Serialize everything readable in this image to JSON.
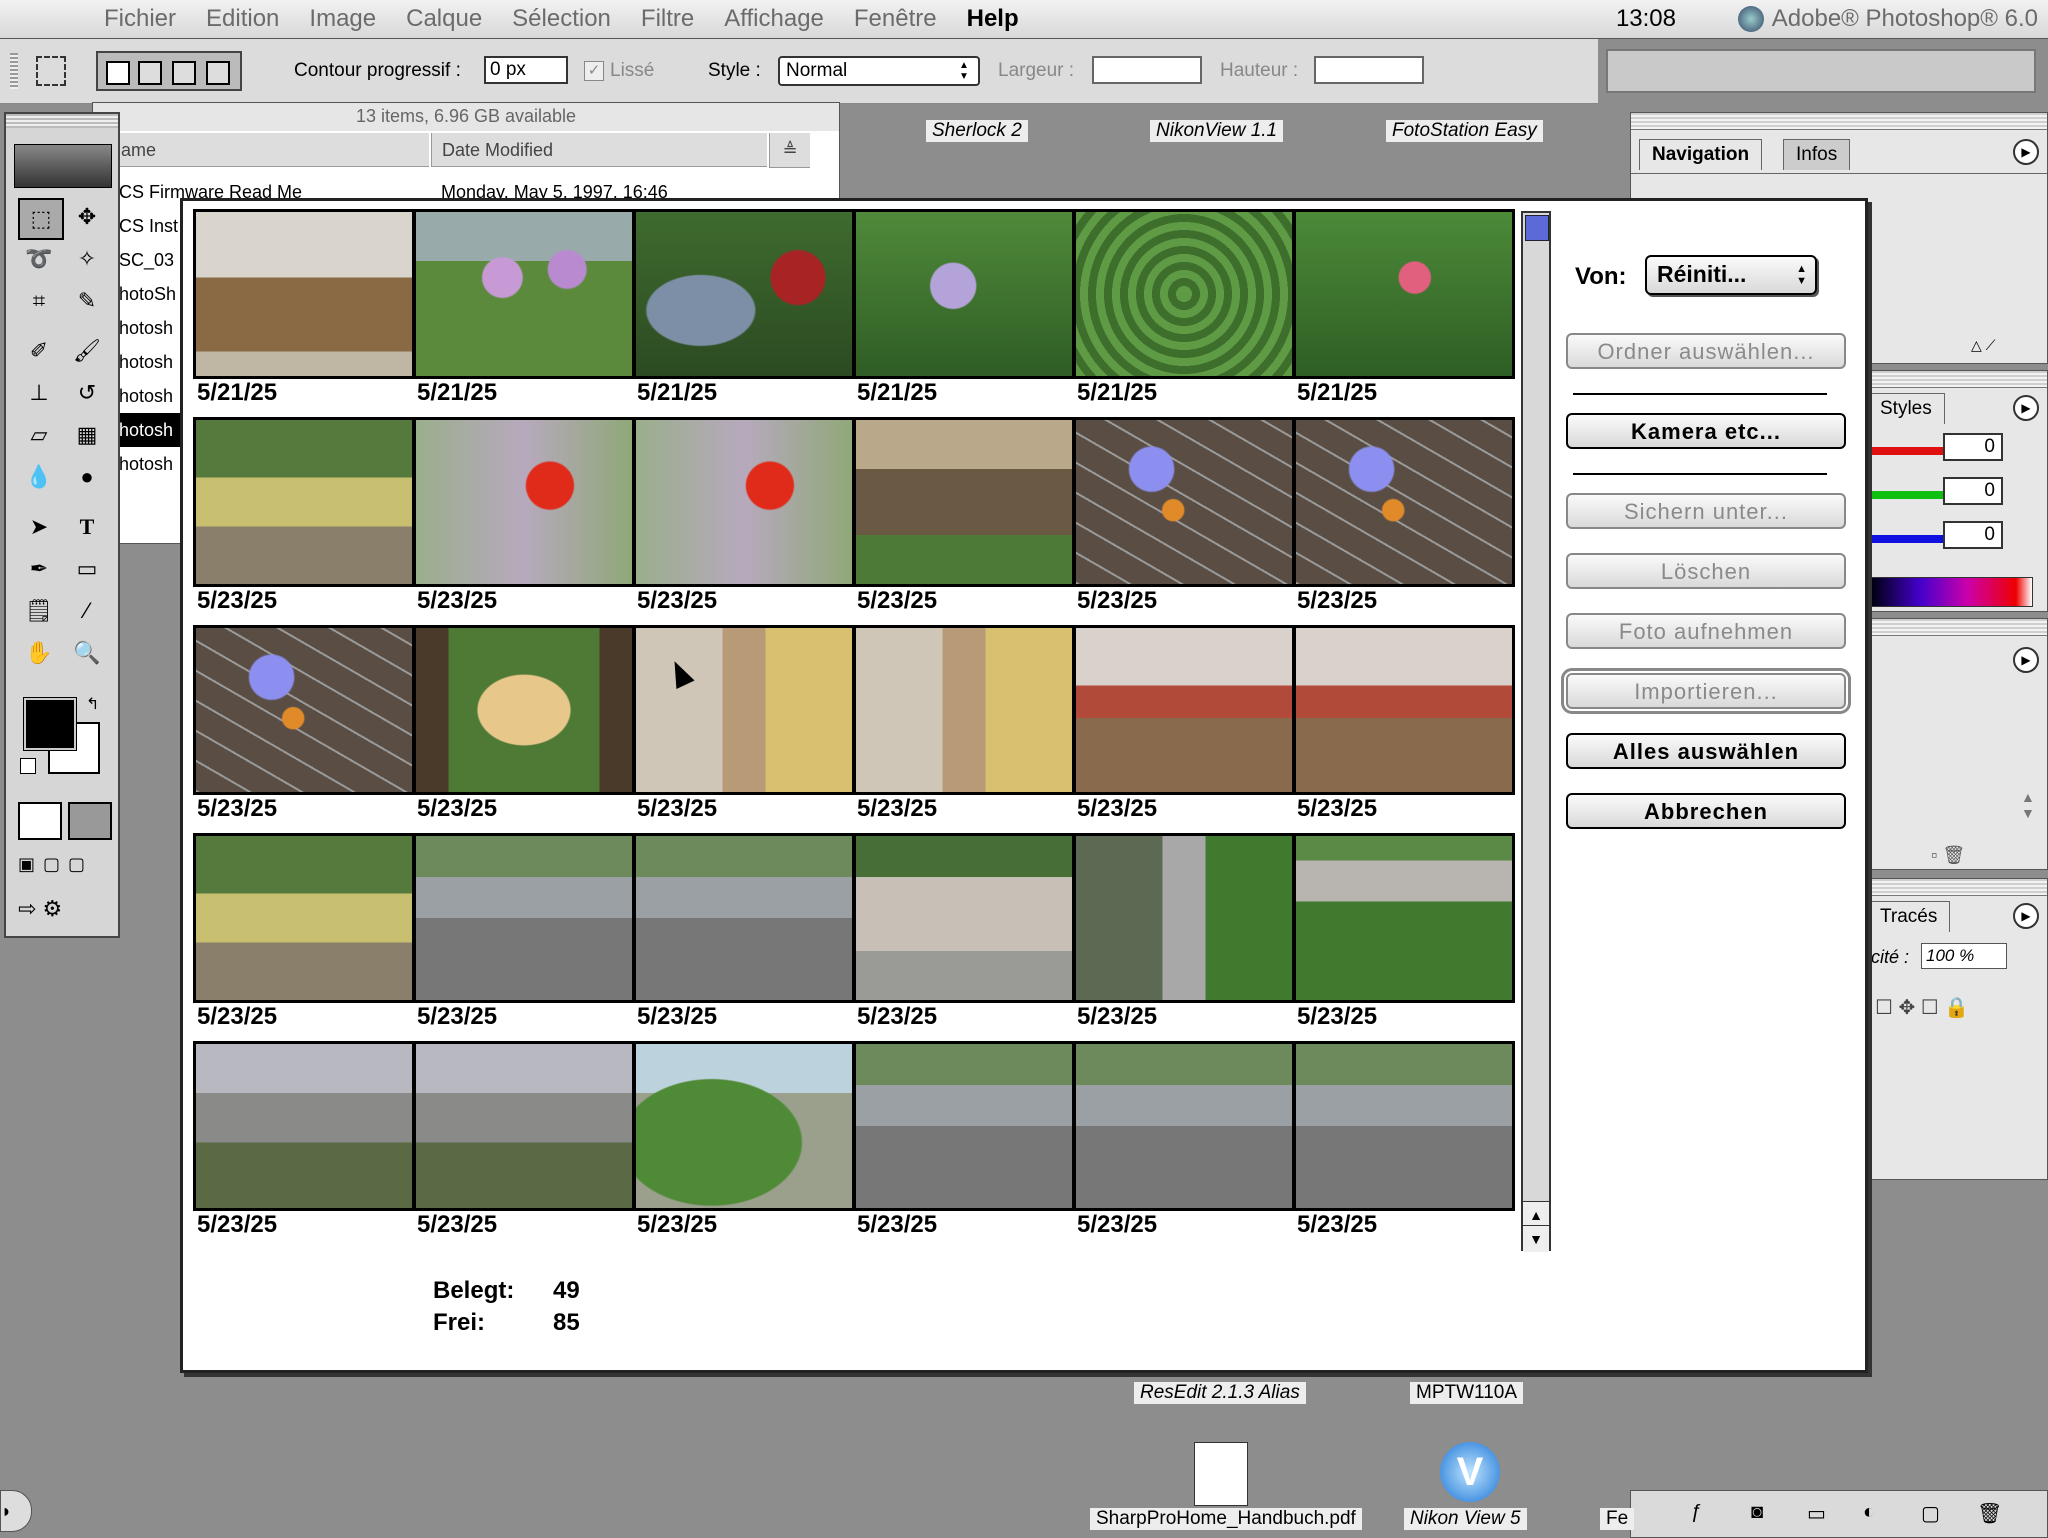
{
  "menubar": {
    "items": [
      "Fichier",
      "Edition",
      "Image",
      "Calque",
      "Sélection",
      "Filtre",
      "Affichage",
      "Fenêtre",
      "Help"
    ],
    "clock": "13:08",
    "app_name": "Adobe® Photoshop® 6.0"
  },
  "options_bar": {
    "feather_label": "Contour progressif :",
    "feather_value": "0 px",
    "antialias_label": "Lissé",
    "style_label": "Style :",
    "style_value": "Normal",
    "width_label": "Largeur :",
    "height_label": "Hauteur :"
  },
  "finder": {
    "status": "13 items, 6.96 GB available",
    "col_name": "ame",
    "col_date": "Date Modified",
    "rows": [
      {
        "name": "CS Firmware Read Me",
        "date": "Monday, May 5, 1997, 16:46"
      },
      {
        "name": "CS Inst",
        "date": ""
      },
      {
        "name": "SC_03",
        "date": ""
      },
      {
        "name": "hotoSh",
        "date": ""
      },
      {
        "name": "hotosh",
        "date": ""
      },
      {
        "name": "hotosh",
        "date": ""
      },
      {
        "name": "hotosh",
        "date": ""
      },
      {
        "name": "hotosh",
        "date": ""
      },
      {
        "name": "hotosh",
        "date": ""
      }
    ]
  },
  "desktop": {
    "top_icons": [
      "Sherlock 2",
      "NikonView 1.1",
      "FotoStation Easy"
    ],
    "bottom_icons": [
      "ResEdit 2.1.3 Alias",
      "MPTW110A",
      "SharpProHome_Handbuch.pdf",
      "Nikon View 5",
      "Fe"
    ]
  },
  "palettes": {
    "nav_tabs": [
      "Navigation",
      "Infos"
    ],
    "color_tab": "Styles",
    "rgb_values": [
      "0",
      "0",
      "0"
    ],
    "paths_tab": "Tracés",
    "opacity_label": "cité :",
    "opacity_value": "100 %"
  },
  "dialog": {
    "source_label": "Von:",
    "source_value": "Réiniti...",
    "buttons": [
      {
        "label": "Ordner auswählen...",
        "state": "disabled"
      },
      {
        "label": "Kamera etc...",
        "state": "default"
      },
      {
        "label": "Sichern unter...",
        "state": "disabled"
      },
      {
        "label": "Löschen",
        "state": "disabled"
      },
      {
        "label": "Foto aufnehmen",
        "state": "disabled"
      },
      {
        "label": "Importieren...",
        "state": "disabled"
      },
      {
        "label": "Alles auswählen",
        "state": "default"
      },
      {
        "label": "Abbrechen",
        "state": "default"
      }
    ],
    "used_label": "Belegt:",
    "used_value": "49",
    "free_label": "Frei:",
    "free_value": "85",
    "thumbnails": [
      {
        "date": "5/21/25",
        "subject": "living-room"
      },
      {
        "date": "5/21/25",
        "subject": "chives-flowers"
      },
      {
        "date": "5/21/25",
        "subject": "lantern-birdhouse"
      },
      {
        "date": "5/21/25",
        "subject": "iris-flower"
      },
      {
        "date": "5/21/25",
        "subject": "green-foliage"
      },
      {
        "date": "5/21/25",
        "subject": "pink-rose"
      },
      {
        "date": "5/23/25",
        "subject": "graffiti-wall"
      },
      {
        "date": "5/23/25",
        "subject": "red-poppy"
      },
      {
        "date": "5/23/25",
        "subject": "red-poppy"
      },
      {
        "date": "5/23/25",
        "subject": "garden-bed"
      },
      {
        "date": "5/23/25",
        "subject": "fence-decoration"
      },
      {
        "date": "5/23/25",
        "subject": "fence-decoration"
      },
      {
        "date": "5/23/25",
        "subject": "fence-decoration"
      },
      {
        "date": "5/23/25",
        "subject": "achtung-sign"
      },
      {
        "date": "5/23/25",
        "subject": "alley-graffiti"
      },
      {
        "date": "5/23/25",
        "subject": "alley-graffiti"
      },
      {
        "date": "5/23/25",
        "subject": "cafe-terrace"
      },
      {
        "date": "5/23/25",
        "subject": "cafe-terrace"
      },
      {
        "date": "5/23/25",
        "subject": "graffiti-wall"
      },
      {
        "date": "5/23/25",
        "subject": "street-traffic"
      },
      {
        "date": "5/23/25",
        "subject": "street-traffic"
      },
      {
        "date": "5/23/25",
        "subject": "kiosk-building"
      },
      {
        "date": "5/23/25",
        "subject": "bikes-bushes"
      },
      {
        "date": "5/23/25",
        "subject": "bushes-graffiti"
      },
      {
        "date": "5/23/25",
        "subject": "bikes-railing"
      },
      {
        "date": "5/23/25",
        "subject": "bikes-railing"
      },
      {
        "date": "5/23/25",
        "subject": "green-bush"
      },
      {
        "date": "5/23/25",
        "subject": "street-traffic"
      },
      {
        "date": "5/23/25",
        "subject": "street-traffic"
      },
      {
        "date": "5/23/25",
        "subject": "street-traffic"
      }
    ]
  },
  "colors": {
    "desktop": "#8d8d8d",
    "scroll_thumb": "#5b6ad6"
  }
}
